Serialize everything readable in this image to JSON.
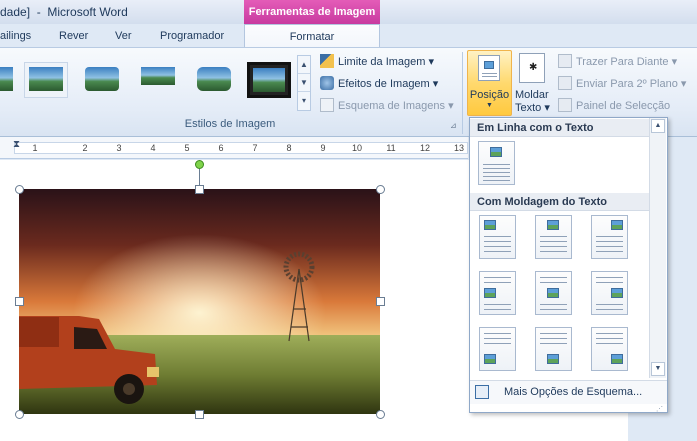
{
  "window": {
    "title": "dade]  -  Microsoft Word",
    "context_title": "Ferramentas de Imagem"
  },
  "tabs": [
    {
      "label": "ailings"
    },
    {
      "label": "Rever"
    },
    {
      "label": "Ver"
    },
    {
      "label": "Programador"
    },
    {
      "label": "Formatar"
    }
  ],
  "ribbon": {
    "group_label": "Estilos de Imagem",
    "limite_label": "Limite da Imagem",
    "efeitos_label": "Efeitos de Imagem",
    "esquema_label": "Esquema de Imagens",
    "posicao_label": "Posição",
    "moldar_label": "Moldar",
    "texto_label": "Texto",
    "trazer_label": "Trazer Para Diante",
    "enviar_label": "Enviar Para 2º Plano",
    "painel_label": "Painel de Selecção"
  },
  "ruler": {
    "numbers": [
      "1",
      "1",
      "2",
      "3",
      "4",
      "5",
      "6",
      "7",
      "8",
      "9",
      "10",
      "11",
      "12",
      "13"
    ]
  },
  "dropdown": {
    "section1": "Em Linha com o Texto",
    "section2": "Com Moldagem do Texto",
    "more_options": "Mais Opções de Esquema..."
  },
  "colors": {
    "context_accent": "#d44aab",
    "position_button_active": "#ffd96e"
  }
}
